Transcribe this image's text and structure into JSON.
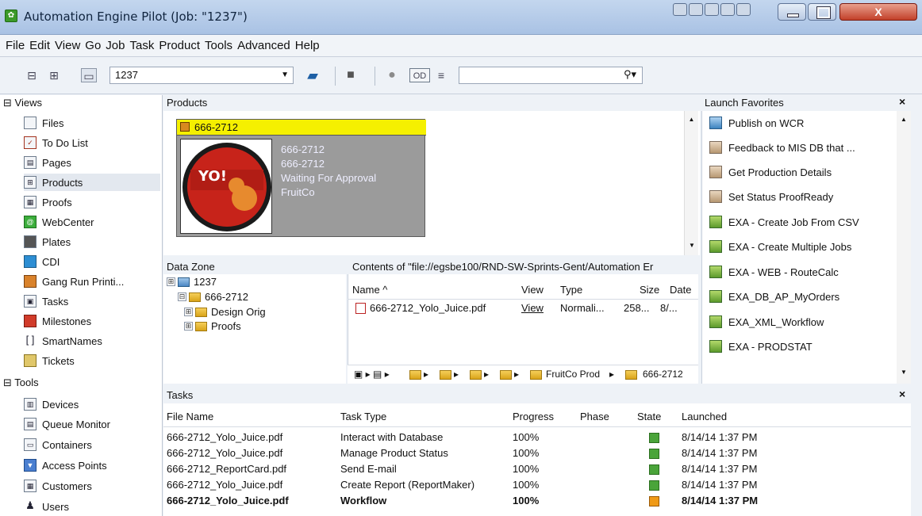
{
  "window": {
    "title": "Automation Engine Pilot (Job: \"1237\")",
    "close_label": "X"
  },
  "menu": [
    "File",
    "Edit",
    "View",
    "Go",
    "Job",
    "Task",
    "Product",
    "Tools",
    "Advanced",
    "Help"
  ],
  "toolbar": {
    "job_value": "1237",
    "search_placeholder": ""
  },
  "views": {
    "heading": "Views",
    "items": [
      "Files",
      "To Do List",
      "Pages",
      "Products",
      "Proofs",
      "WebCenter",
      "Plates",
      "CDI",
      "Gang Run Printi...",
      "Tasks",
      "Milestones",
      "SmartNames",
      "Tickets"
    ],
    "selected": "Products"
  },
  "tools": {
    "heading": "Tools",
    "items": [
      "Devices",
      "Queue Monitor",
      "Containers",
      "Access Points",
      "Customers",
      "Users"
    ]
  },
  "products": {
    "title": "Products",
    "card": {
      "header": "666-2712",
      "lines": [
        "666-2712",
        "666-2712",
        "Waiting For Approval",
        "FruitCo"
      ],
      "thumb_text": "YO!"
    }
  },
  "datazone": {
    "title": "Data Zone",
    "tree": [
      {
        "label": "1237",
        "expander": "⊞"
      },
      {
        "label": "666-2712",
        "expander": "⊟"
      },
      {
        "label": "Design Orig",
        "expander": "⊞"
      },
      {
        "label": "Proofs",
        "expander": "⊞"
      }
    ]
  },
  "contents": {
    "title": "Contents of \"file://egsbe100/RND-SW-Sprints-Gent/Automation Er",
    "columns": [
      "Name ^",
      "View",
      "Type",
      "Size",
      "Date"
    ],
    "rows": [
      {
        "name": "666-2712_Yolo_Juice.pdf",
        "view": "View",
        "type": "Normali...",
        "size": "258...",
        "date": "8/..."
      }
    ],
    "breadcrumb": [
      "FruitCo Prod",
      "666-2712"
    ]
  },
  "favorites": {
    "title": "Launch Favorites",
    "close": "×",
    "items": [
      {
        "label": "Publish on WCR",
        "kind": "web"
      },
      {
        "label": "Feedback to MIS DB that ...",
        "kind": "db"
      },
      {
        "label": "Get Production Details",
        "kind": "db"
      },
      {
        "label": "Set Status ProofReady",
        "kind": "db"
      },
      {
        "label": "EXA - Create Job From CSV",
        "kind": "wf"
      },
      {
        "label": "EXA - Create Multiple Jobs",
        "kind": "wf"
      },
      {
        "label": "EXA - WEB - RouteCalc",
        "kind": "wf"
      },
      {
        "label": "EXA_DB_AP_MyOrders",
        "kind": "wf"
      },
      {
        "label": "EXA_XML_Workflow",
        "kind": "wf"
      },
      {
        "label": "EXA - PRODSTAT",
        "kind": "wf"
      }
    ]
  },
  "tasks": {
    "title": "Tasks",
    "close": "×",
    "columns": [
      "File Name",
      "Task Type",
      "Progress",
      "Phase",
      "State",
      "Launched"
    ],
    "rows": [
      {
        "file": "666-2712_Yolo_Juice.pdf",
        "type": "Interact with Database",
        "progress": "100%",
        "phase": "",
        "state": "ok",
        "launched": "8/14/14 1:37 PM"
      },
      {
        "file": "666-2712_Yolo_Juice.pdf",
        "type": "Manage Product Status",
        "progress": "100%",
        "phase": "",
        "state": "ok",
        "launched": "8/14/14 1:37 PM"
      },
      {
        "file": "666-2712_ReportCard.pdf",
        "type": "Send E-mail",
        "progress": "100%",
        "phase": "",
        "state": "ok",
        "launched": "8/14/14 1:37 PM"
      },
      {
        "file": "666-2712_Yolo_Juice.pdf",
        "type": "Create Report (ReportMaker)",
        "progress": "100%",
        "phase": "",
        "state": "ok",
        "launched": "8/14/14 1:37 PM"
      },
      {
        "file": "666-2712_Yolo_Juice.pdf",
        "type": "Workflow",
        "progress": "100%",
        "phase": "",
        "state": "warn",
        "launched": "8/14/14 1:37 PM"
      }
    ]
  },
  "colors": {
    "accent": "#f5f000",
    "ok": "#4aa43a",
    "warn": "#f09a17"
  }
}
